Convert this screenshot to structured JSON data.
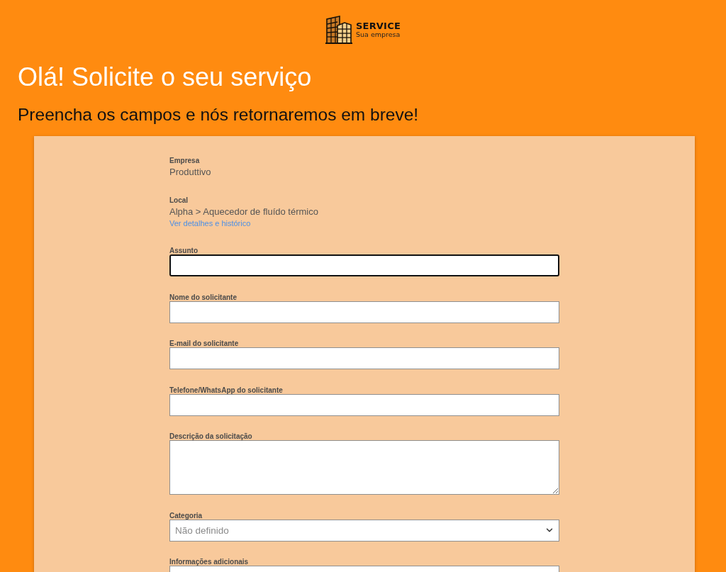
{
  "header": {
    "logo": {
      "title": "SERVICE",
      "subtitle": "Sua empresa"
    },
    "title": "Olá! Solicite o seu serviço",
    "subtitle": "Preencha os campos e nós retornaremos em breve!"
  },
  "form": {
    "info": [
      {
        "label": "Empresa",
        "value": "Produttivo"
      },
      {
        "label": "Local",
        "value": "Alpha > Aquecedor de fluído térmico",
        "link": "Ver detalhes e histórico"
      }
    ],
    "fields": [
      {
        "kind": "text",
        "label": "Assunto",
        "focused": true
      },
      {
        "kind": "text",
        "label": "Nome do solicitante",
        "focused": false
      },
      {
        "kind": "text",
        "label": "E-mail do solicitante",
        "focused": false
      },
      {
        "kind": "text",
        "label": "Telefone/WhatsApp do solicitante",
        "focused": false
      },
      {
        "kind": "textarea",
        "label": "Descrição da solicitação",
        "focused": false
      },
      {
        "kind": "select",
        "label": "Categoria",
        "placeholder": "Não definido",
        "focused": false
      },
      {
        "kind": "text",
        "label": "Informações adicionais",
        "focused": false
      }
    ]
  }
}
